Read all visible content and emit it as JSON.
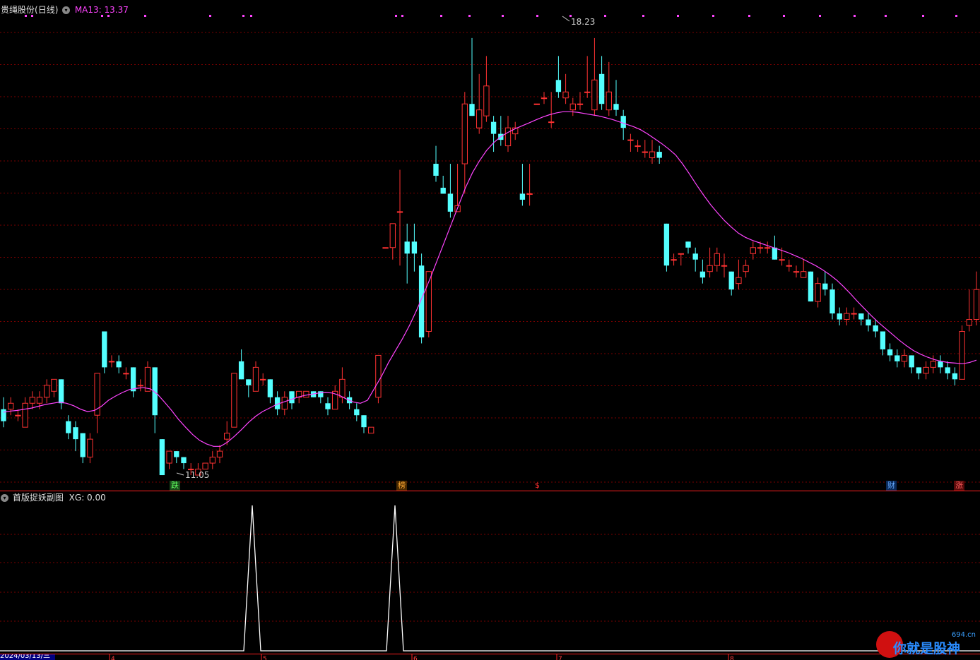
{
  "main_panel": {
    "stock_name": "贵绳股份",
    "period": "(日线)",
    "ma_label": "MA13: 13.37",
    "high_marker": "18.23",
    "low_marker": "11.05",
    "colors": {
      "up": "#ff3232",
      "down": "#54ffff",
      "ma": "#ff44ff",
      "grid": "#7a0000",
      "separator": "#ff0000"
    }
  },
  "event_badges": [
    {
      "label": "跌",
      "kind": "down"
    },
    {
      "label": "榜",
      "kind": "list"
    },
    {
      "label": "$",
      "kind": "money"
    },
    {
      "label": "财",
      "kind": "finance"
    },
    {
      "label": "涨",
      "kind": "up"
    }
  ],
  "sub_panel": {
    "indicator_name": "首版捉妖副图",
    "xg_label": "XG: 0.00",
    "signal_color": "#ffffff"
  },
  "footer": {
    "date_label": "2024/03/13/三",
    "axis_ticks": [
      "4",
      "5",
      "6",
      "7",
      "8"
    ]
  },
  "watermark": {
    "site": "694.cn",
    "slogan": "你就是股神"
  },
  "chart_data": {
    "type": "candlestick",
    "ma_period": 13,
    "yrange": [
      10.7,
      18.6
    ],
    "candles": [
      [
        12.0,
        11.8,
        12.2,
        11.7
      ],
      [
        12.0,
        12.1,
        12.2,
        11.9
      ],
      [
        11.9,
        11.9,
        12.0,
        11.8
      ],
      [
        11.7,
        12.1,
        12.2,
        11.7
      ],
      [
        12.1,
        12.2,
        12.3,
        12.0
      ],
      [
        12.1,
        12.2,
        12.3,
        12.0
      ],
      [
        12.2,
        12.4,
        12.5,
        12.1
      ],
      [
        12.3,
        12.5,
        12.5,
        12.2
      ],
      [
        12.5,
        12.1,
        12.5,
        12.0
      ],
      [
        11.8,
        11.6,
        11.9,
        11.5
      ],
      [
        11.7,
        11.5,
        11.8,
        11.3
      ],
      [
        11.6,
        11.2,
        11.6,
        11.1
      ],
      [
        11.2,
        11.5,
        11.6,
        11.1
      ],
      [
        11.9,
        12.6,
        12.6,
        11.6
      ],
      [
        13.3,
        12.7,
        13.3,
        12.6
      ],
      [
        12.8,
        12.8,
        12.9,
        12.7
      ],
      [
        12.8,
        12.7,
        12.9,
        12.6
      ],
      [
        12.6,
        12.6,
        12.7,
        12.5
      ],
      [
        12.7,
        12.3,
        12.7,
        12.2
      ],
      [
        12.4,
        12.4,
        12.5,
        12.3
      ],
      [
        12.3,
        12.7,
        12.8,
        12.3
      ],
      [
        12.7,
        11.9,
        12.7,
        11.6
      ],
      [
        11.5,
        10.9,
        11.5,
        10.9
      ],
      [
        11.1,
        11.3,
        11.3,
        11.0
      ],
      [
        11.3,
        11.2,
        11.3,
        11.1
      ],
      [
        11.2,
        11.1,
        11.2,
        11.0
      ],
      [
        11.0,
        11.0,
        11.1,
        10.9
      ],
      [
        10.9,
        11.0,
        11.1,
        10.9
      ],
      [
        11.0,
        11.1,
        11.1,
        11.0
      ],
      [
        11.1,
        11.2,
        11.3,
        11.0
      ],
      [
        11.2,
        11.3,
        11.4,
        11.1
      ],
      [
        11.5,
        11.6,
        11.8,
        11.4
      ],
      [
        11.7,
        12.6,
        12.6,
        11.7
      ],
      [
        12.8,
        12.5,
        13.0,
        12.5
      ],
      [
        12.5,
        12.4,
        12.5,
        12.2
      ],
      [
        12.3,
        12.7,
        12.8,
        12.3
      ],
      [
        12.5,
        12.5,
        12.6,
        12.4
      ],
      [
        12.5,
        12.2,
        12.5,
        12.1
      ],
      [
        12.2,
        12.0,
        12.3,
        11.9
      ],
      [
        12.0,
        12.2,
        12.3,
        11.9
      ],
      [
        12.3,
        12.1,
        12.3,
        12.0
      ],
      [
        12.2,
        12.3,
        12.3,
        12.1
      ],
      [
        12.2,
        12.3,
        12.3,
        12.2
      ],
      [
        12.3,
        12.2,
        12.3,
        12.2
      ],
      [
        12.3,
        12.2,
        12.3,
        12.1
      ],
      [
        12.1,
        12.0,
        12.2,
        11.9
      ],
      [
        12.0,
        12.3,
        12.4,
        12.0
      ],
      [
        12.2,
        12.5,
        12.7,
        12.1
      ],
      [
        12.2,
        12.1,
        12.3,
        12.0
      ],
      [
        12.0,
        11.9,
        12.1,
        11.8
      ],
      [
        11.9,
        11.7,
        11.9,
        11.6
      ],
      [
        11.6,
        11.7,
        11.7,
        11.6
      ],
      [
        12.2,
        12.9,
        12.9,
        12.1
      ],
      [
        14.7,
        14.7,
        14.7,
        14.7
      ],
      [
        14.7,
        15.1,
        15.1,
        14.5
      ],
      [
        15.3,
        15.3,
        16.0,
        14.4
      ],
      [
        14.8,
        14.6,
        15.1,
        14.1
      ],
      [
        14.8,
        14.6,
        15.1,
        14.3
      ],
      [
        14.4,
        13.2,
        14.6,
        13.1
      ],
      [
        13.3,
        14.3,
        14.3,
        13.2
      ],
      [
        16.1,
        15.9,
        16.4,
        15.8
      ],
      [
        15.7,
        15.6,
        15.9,
        15.6
      ],
      [
        15.6,
        15.3,
        16.1,
        15.2
      ],
      [
        15.3,
        15.4,
        16.1,
        15.3
      ],
      [
        16.1,
        17.1,
        17.3,
        15.6
      ],
      [
        17.1,
        16.9,
        18.2,
        16.9
      ],
      [
        16.7,
        17.0,
        17.6,
        16.6
      ],
      [
        16.9,
        17.4,
        17.9,
        16.8
      ],
      [
        16.8,
        16.6,
        16.9,
        16.3
      ],
      [
        16.6,
        16.5,
        16.9,
        16.4
      ],
      [
        16.4,
        16.7,
        16.9,
        16.3
      ],
      [
        16.6,
        16.7,
        16.8,
        16.5
      ],
      [
        15.6,
        15.5,
        16.1,
        15.4
      ],
      [
        15.6,
        15.6,
        16.1,
        15.4
      ],
      [
        17.1,
        17.1,
        17.1,
        17.1
      ],
      [
        17.2,
        17.2,
        17.3,
        17.1
      ],
      [
        16.8,
        16.8,
        17.3,
        16.7
      ],
      [
        17.5,
        17.3,
        17.9,
        17.2
      ],
      [
        17.2,
        17.3,
        17.6,
        17.1
      ],
      [
        17.0,
        17.1,
        17.2,
        16.9
      ],
      [
        17.1,
        17.1,
        17.3,
        17.0
      ],
      [
        17.3,
        17.3,
        17.9,
        17.2
      ],
      [
        17.0,
        17.5,
        18.2,
        16.9
      ],
      [
        17.6,
        17.1,
        17.9,
        17.0
      ],
      [
        17.0,
        17.3,
        17.8,
        16.9
      ],
      [
        17.1,
        17.0,
        17.5,
        16.9
      ],
      [
        16.9,
        16.7,
        17.0,
        16.5
      ],
      [
        16.5,
        16.5,
        16.6,
        16.3
      ],
      [
        16.4,
        16.4,
        16.5,
        16.3
      ],
      [
        16.3,
        16.3,
        16.5,
        16.2
      ],
      [
        16.2,
        16.3,
        16.5,
        16.1
      ],
      [
        16.3,
        16.2,
        16.4,
        16.1
      ],
      [
        15.1,
        14.4,
        15.1,
        14.3
      ],
      [
        14.5,
        14.5,
        14.6,
        14.4
      ],
      [
        14.6,
        14.6,
        14.6,
        14.4
      ],
      [
        14.8,
        14.7,
        14.8,
        14.6
      ],
      [
        14.6,
        14.5,
        14.7,
        14.3
      ],
      [
        14.3,
        14.2,
        14.5,
        14.1
      ],
      [
        14.3,
        14.4,
        14.7,
        14.2
      ],
      [
        14.4,
        14.6,
        14.7,
        14.3
      ],
      [
        14.4,
        14.4,
        14.6,
        14.2
      ],
      [
        14.3,
        14.0,
        14.3,
        13.9
      ],
      [
        14.1,
        14.2,
        14.5,
        14.0
      ],
      [
        14.3,
        14.4,
        14.5,
        14.2
      ],
      [
        14.6,
        14.7,
        14.8,
        14.5
      ],
      [
        14.7,
        14.7,
        14.8,
        14.6
      ],
      [
        14.7,
        14.7,
        14.8,
        14.6
      ],
      [
        14.7,
        14.5,
        14.9,
        14.5
      ],
      [
        14.5,
        14.5,
        14.7,
        14.4
      ],
      [
        14.4,
        14.4,
        14.5,
        14.3
      ],
      [
        14.3,
        14.3,
        14.4,
        14.2
      ],
      [
        14.2,
        14.3,
        14.5,
        14.2
      ],
      [
        14.3,
        13.8,
        14.3,
        13.8
      ],
      [
        13.8,
        14.1,
        14.2,
        13.7
      ],
      [
        14.1,
        14.0,
        14.3,
        13.9
      ],
      [
        14.0,
        13.6,
        14.1,
        13.5
      ],
      [
        13.6,
        13.5,
        13.7,
        13.4
      ],
      [
        13.5,
        13.6,
        13.7,
        13.4
      ],
      [
        13.6,
        13.6,
        13.7,
        13.5
      ],
      [
        13.6,
        13.5,
        13.6,
        13.4
      ],
      [
        13.5,
        13.4,
        13.6,
        13.3
      ],
      [
        13.4,
        13.3,
        13.5,
        13.2
      ],
      [
        13.3,
        13.0,
        13.3,
        12.9
      ],
      [
        13.0,
        12.9,
        13.1,
        12.8
      ],
      [
        12.9,
        12.8,
        13.0,
        12.7
      ],
      [
        12.8,
        12.9,
        13.0,
        12.7
      ],
      [
        12.9,
        12.7,
        12.9,
        12.6
      ],
      [
        12.7,
        12.6,
        12.7,
        12.5
      ],
      [
        12.6,
        12.7,
        12.8,
        12.5
      ],
      [
        12.7,
        12.8,
        12.9,
        12.6
      ],
      [
        12.8,
        12.7,
        12.9,
        12.6
      ],
      [
        12.7,
        12.6,
        12.8,
        12.5
      ],
      [
        12.6,
        12.5,
        12.7,
        12.4
      ],
      [
        12.5,
        13.3,
        13.4,
        12.5
      ],
      [
        13.4,
        13.5,
        14.0,
        13.3
      ],
      [
        13.5,
        14.0,
        14.3,
        13.4
      ]
    ],
    "ma13": [
      11.95,
      11.97,
      11.98,
      12.0,
      12.02,
      12.05,
      12.08,
      12.1,
      12.12,
      12.1,
      12.06,
      12.0,
      11.96,
      11.98,
      12.05,
      12.15,
      12.22,
      12.28,
      12.33,
      12.35,
      12.36,
      12.34,
      12.25,
      12.12,
      11.98,
      11.83,
      11.7,
      11.58,
      11.48,
      11.42,
      11.38,
      11.38,
      11.45,
      11.55,
      11.66,
      11.78,
      11.88,
      11.96,
      12.02,
      12.08,
      12.12,
      12.16,
      12.2,
      12.23,
      12.25,
      12.27,
      12.28,
      12.27,
      12.23,
      12.17,
      12.12,
      12.1,
      12.15,
      12.35,
      12.55,
      12.78,
      12.98,
      13.18,
      13.4,
      13.65,
      13.92,
      14.2,
      14.5,
      14.8,
      15.1,
      15.4,
      15.7,
      15.95,
      16.15,
      16.32,
      16.45,
      16.55,
      16.62,
      16.68,
      16.73,
      16.78,
      16.83,
      16.88,
      16.92,
      16.95,
      16.97,
      16.97,
      16.96,
      16.94,
      16.92,
      16.9,
      16.87,
      16.84,
      16.8,
      16.76,
      16.72,
      16.67,
      16.6,
      16.52,
      16.44,
      16.35,
      16.25,
      16.1,
      15.93,
      15.75,
      15.58,
      15.42,
      15.28,
      15.15,
      15.04,
      14.94,
      14.87,
      14.82,
      14.78,
      14.74,
      14.7,
      14.66,
      14.62,
      14.57,
      14.52,
      14.46,
      14.4,
      14.33,
      14.25,
      14.16,
      14.05,
      13.93,
      13.8,
      13.68,
      13.56,
      13.45,
      13.35,
      13.25,
      13.15,
      13.06,
      12.98,
      12.92,
      12.87,
      12.83,
      12.8,
      12.78,
      12.77,
      12.76,
      12.78,
      12.82
    ]
  }
}
